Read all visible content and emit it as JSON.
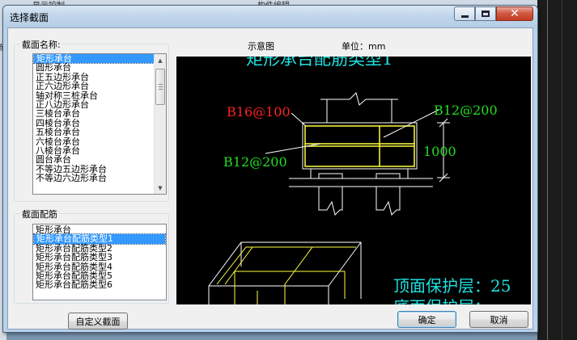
{
  "background": {
    "top_text_1": "显示控制",
    "top_text_2": "构件编辑",
    "left_text": "施"
  },
  "window": {
    "title": "选择截面"
  },
  "section_name": {
    "label": "截面名称:",
    "items": [
      "矩形承台",
      "圆形承台",
      "正五边形承台",
      "正六边形承台",
      "轴对称三桩承台",
      "正八边形承台",
      "三棱台承台",
      "四棱台承台",
      "五棱台承台",
      "六棱台承台",
      "八棱台承台",
      "圆台承台",
      "不等边五边形承台",
      "不等边六边形承台"
    ],
    "selected_index": 0
  },
  "section_rebar": {
    "label": "截面配筋",
    "items": [
      "矩形承台",
      "矩形承台配筋类型1",
      "矩形承台配筋类型2",
      "矩形承台配筋类型3",
      "矩形承台配筋类型4",
      "矩形承台配筋类型5",
      "矩形承台配筋类型6"
    ],
    "selected_index": 1
  },
  "preview": {
    "header_label": "示意图",
    "unit_label": "单位：mm",
    "drawing_title": "矩形承台配筋类型1",
    "rebar_top": "B16@100",
    "rebar_right": "B12@200",
    "rebar_left": "B12@200",
    "height_dim": "1000",
    "cover_top": "顶面保护层：25",
    "cover_bottom": "底面保护层：",
    "colors": {
      "background": "#000000",
      "red_text": "#ff2020",
      "green_text": "#22dd22",
      "cyan_text": "#20e0e0",
      "yellow_line": "#ffff40",
      "white_line": "#ffffff"
    }
  },
  "buttons": {
    "custom": "自定义截面",
    "ok": "确定",
    "cancel": "取消"
  }
}
